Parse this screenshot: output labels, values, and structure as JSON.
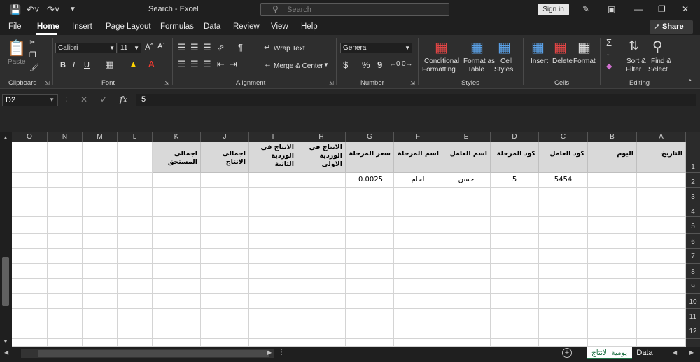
{
  "title_bar": {
    "title": "Search  -  Excel",
    "search_placeholder": "Search",
    "sign_in": "Sign in"
  },
  "menu": {
    "tabs": [
      "File",
      "Home",
      "Insert",
      "Page Layout",
      "Formulas",
      "Data",
      "Review",
      "View",
      "Help"
    ],
    "active": "Home",
    "share": "Share"
  },
  "ribbon": {
    "clipboard": {
      "label": "Clipboard",
      "paste": "Paste"
    },
    "font": {
      "label": "Font",
      "name": "Calibri",
      "size": "11",
      "bold": "B",
      "italic": "I",
      "underline": "U"
    },
    "alignment": {
      "label": "Alignment",
      "wrap_text": "Wrap Text",
      "merge_center": "Merge & Center"
    },
    "number": {
      "label": "Number",
      "format": "General",
      "currency": "$",
      "percent": "%",
      "comma": "9"
    },
    "styles": {
      "label": "Styles",
      "conditional_1": "Conditional",
      "conditional_2": "Formatting",
      "format_table_1": "Format as",
      "format_table_2": "Table",
      "cell_styles_1": "Cell",
      "cell_styles_2": "Styles"
    },
    "cells": {
      "label": "Cells",
      "insert": "Insert",
      "delete": "Delete",
      "format": "Format"
    },
    "editing": {
      "label": "Editing",
      "sort_1": "Sort &",
      "sort_2": "Filter",
      "find_1": "Find &",
      "find_2": "Select"
    }
  },
  "formula_bar": {
    "name_box": "D2",
    "fx": "fx",
    "value": "5"
  },
  "columns": [
    "O",
    "N",
    "M",
    "L",
    "K",
    "J",
    "I",
    "H",
    "G",
    "F",
    "E",
    "D",
    "C",
    "B",
    "A"
  ],
  "rows": [
    "1",
    "2",
    "3",
    "4",
    "5",
    "6",
    "7",
    "8",
    "9",
    "10",
    "11",
    "12"
  ],
  "headers": {
    "A": "التاريخ",
    "B": "اليوم",
    "C": "كود العامل",
    "D": "كود المرحلة",
    "E": "اسم العامل",
    "F": "اسم المرحلة",
    "G": "سعر المرحلة",
    "H": "الانتاج فى الوردية الاولى",
    "I": "الانتاج فى الوردية الثانية",
    "J": "اجمالى الانتاج",
    "K": "اجمالى المستحق"
  },
  "row2": {
    "C": "5454",
    "D": "5",
    "E": "حسن",
    "F": "لحام",
    "G": "0.0025"
  },
  "sheets": {
    "active": "يومية الانتاج",
    "other": "Data"
  }
}
